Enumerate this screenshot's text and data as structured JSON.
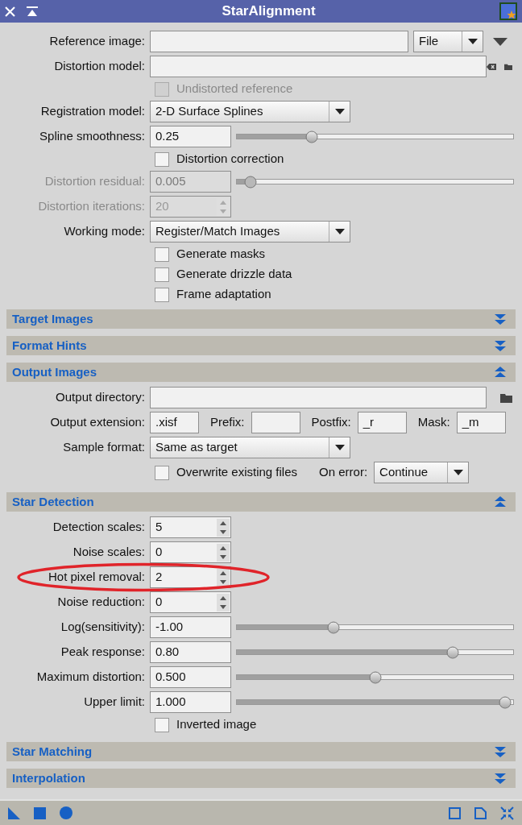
{
  "window": {
    "title": "StarAlignment"
  },
  "rows": [
    {
      "kind": "file",
      "label": "Reference image:",
      "combo": "File",
      "disabled": false
    },
    {
      "kind": "path",
      "label": "Distortion model:",
      "clear": true,
      "disabled": false
    },
    {
      "kind": "checkbox",
      "label": "Undistorted reference",
      "checked": false,
      "disabled": true
    },
    {
      "kind": "combo",
      "label": "Registration model:",
      "value": "2-D Surface Splines",
      "disabled": false
    },
    {
      "kind": "slider",
      "label": "Spline smoothness:",
      "value": "0.25",
      "level": 0.27,
      "disabled": false
    },
    {
      "kind": "checkbox",
      "label": "Distortion correction",
      "checked": false,
      "disabled": false
    },
    {
      "kind": "slider",
      "label": "Distortion residual:",
      "value": "0.005",
      "level": 0.05,
      "disabled": true
    },
    {
      "kind": "spin",
      "label": "Distortion iterations:",
      "value": "20",
      "disabled": true
    },
    {
      "kind": "combo",
      "label": "Working mode:",
      "value": "Register/Match Images",
      "disabled": false
    },
    {
      "kind": "checkbox",
      "label": "Generate masks",
      "checked": false,
      "disabled": false
    },
    {
      "kind": "checkbox",
      "label": "Generate drizzle data",
      "checked": false,
      "disabled": false
    },
    {
      "kind": "checkbox",
      "label": "Frame adaptation",
      "checked": false,
      "disabled": false
    }
  ],
  "sections": [
    {
      "title": "Target Images",
      "expanded": false
    },
    {
      "title": "Format Hints",
      "expanded": false
    },
    {
      "title": "Output Images",
      "expanded": true,
      "rows": [
        {
          "kind": "path",
          "label": "Output directory:",
          "clear": false,
          "disabled": false
        },
        {
          "kind": "fields",
          "label": "Output extension:",
          "value": ".xisf",
          "fields": [
            {
              "label": "Prefix:"
            },
            {
              "label": "Postfix:",
              "value": "_r"
            },
            {
              "label": "Mask:",
              "value": "_m"
            }
          ],
          "disabled": false
        },
        {
          "kind": "combo",
          "label": "Sample format:",
          "value": "Same as target",
          "disabled": false
        },
        {
          "kind": "check_combo",
          "text": "Overwrite existing files",
          "checked": false,
          "label": "On error:",
          "value": "Continue",
          "disabled": false
        }
      ]
    },
    {
      "title": "Star Detection",
      "expanded": true,
      "rows": [
        {
          "kind": "spin",
          "label": "Detection scales:",
          "value": "5",
          "disabled": false
        },
        {
          "kind": "spin",
          "label": "Noise scales:",
          "value": "0",
          "disabled": false
        },
        {
          "kind": "spin",
          "label": "Hot pixel removal:",
          "value": "2",
          "disabled": false,
          "highlighted": true
        },
        {
          "kind": "spin",
          "label": "Noise reduction:",
          "value": "0",
          "disabled": false
        },
        {
          "kind": "slider",
          "label": "Log(sensitivity):",
          "value": "-1.00",
          "level": 0.35,
          "disabled": false
        },
        {
          "kind": "slider",
          "label": "Peak response:",
          "value": "0.80",
          "level": 0.78,
          "disabled": false
        },
        {
          "kind": "slider",
          "label": "Maximum distortion:",
          "value": "0.500",
          "level": 0.5,
          "disabled": false
        },
        {
          "kind": "slider",
          "label": "Upper limit:",
          "value": "1.000",
          "level": 0.97,
          "disabled": false
        },
        {
          "kind": "checkbox",
          "label": "Inverted image",
          "checked": false,
          "disabled": false
        }
      ]
    },
    {
      "title": "Star Matching",
      "expanded": false
    },
    {
      "title": "Interpolation",
      "expanded": false
    }
  ]
}
